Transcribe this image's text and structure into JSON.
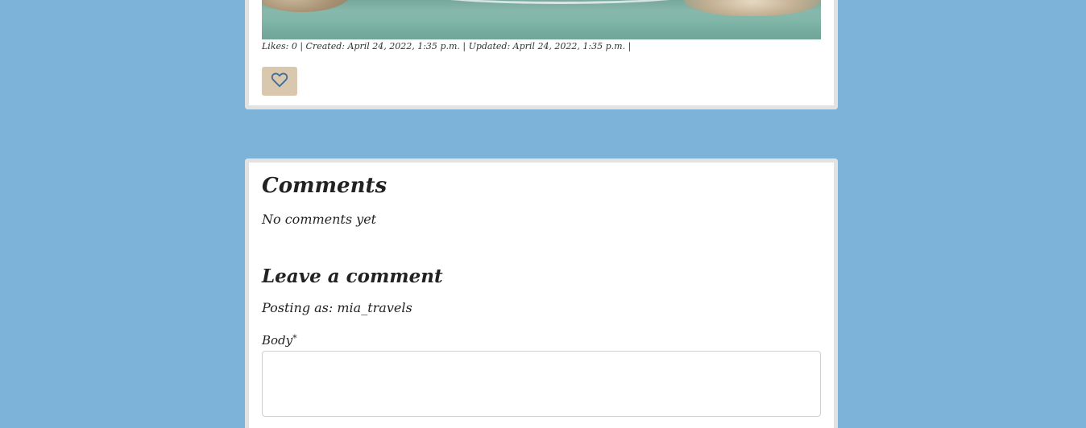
{
  "post": {
    "meta": "Likes: 0 | Created: April 24, 2022, 1:35 p.m. | Updated: April 24, 2022, 1:35 p.m. |",
    "like_icon": "heart-outline-icon"
  },
  "comments": {
    "title": "Comments",
    "empty_text": "No comments yet",
    "form": {
      "title": "Leave a comment",
      "posting_as_prefix": "Posting as: ",
      "username": "mia_travels",
      "body_label": "Body",
      "required_mark": "*",
      "body_value": ""
    }
  },
  "colors": {
    "page_background": "#7db3d8",
    "card_border": "#e2e2e2",
    "like_button": "#d9c7ae",
    "heart_stroke": "#3f6e9a"
  }
}
